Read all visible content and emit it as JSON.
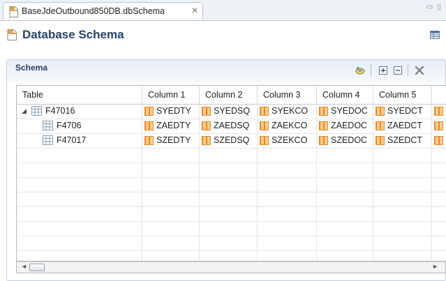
{
  "editor_tab": {
    "title": "BaseJdeOutbound850DB.dbSchema",
    "close_glyph": "✕"
  },
  "window_controls": {
    "minimize": "▭",
    "maximize": "▯"
  },
  "header": {
    "title": "Database Schema",
    "icon": "schema-file-icon",
    "menu_icon": "view-menu-icon"
  },
  "section": {
    "title": "Schema",
    "toolbar": [
      {
        "name": "refresh-icon"
      },
      {
        "name": "expand-all-icon"
      },
      {
        "name": "collapse-all-icon"
      },
      {
        "name": "delete-icon"
      }
    ]
  },
  "table": {
    "columns": [
      "Table",
      "Column 1",
      "Column 2",
      "Column 3",
      "Column 4",
      "Column 5"
    ],
    "rows": [
      {
        "name": "F47016",
        "expanded": true,
        "cells": [
          "SYEDTY",
          "SYEDSQ",
          "SYEKCO",
          "SYEDOC",
          "SYEDCT"
        ]
      },
      {
        "name": "F4706",
        "cells": [
          "ZAEDTY",
          "ZAEDSQ",
          "ZAEKCO",
          "ZAEDOC",
          "ZAEDCT"
        ]
      },
      {
        "name": "F47017",
        "cells": [
          "SZEDTY",
          "SZEDSQ",
          "SZEKCO",
          "SZEDOC",
          "SZEDCT"
        ]
      }
    ]
  },
  "scrollbar": {
    "left_arrow": "◄",
    "right_arrow": "►"
  },
  "colors": {
    "accent": "#24426b",
    "column_icon": "#e8882a"
  }
}
